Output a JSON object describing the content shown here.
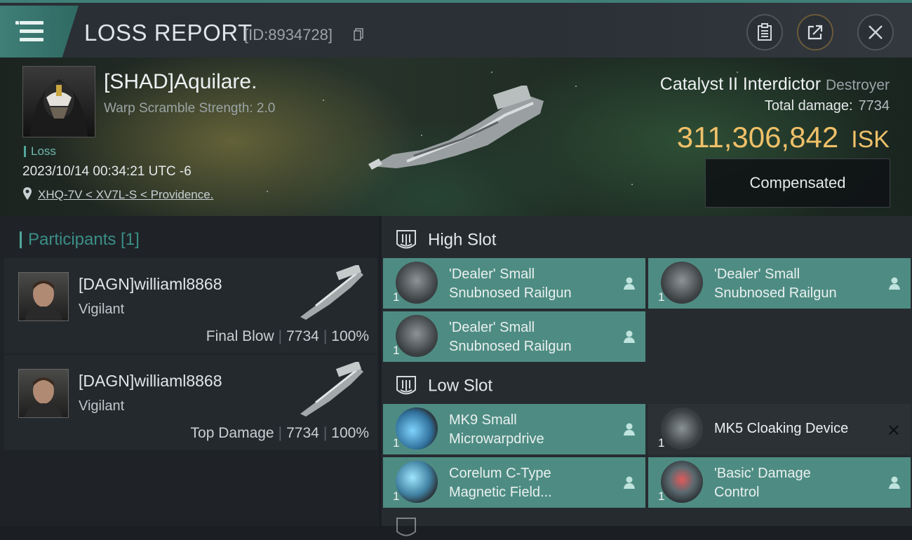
{
  "header": {
    "title": "LOSS REPORT",
    "report_id": "[ID:8934728]"
  },
  "victim": {
    "pilot": "[SHAD]Aquilare.",
    "warp_scramble": "Warp Scramble Strength: 2.0",
    "tag": "Loss",
    "timestamp": "2023/10/14 00:34:21 UTC -6",
    "location": "XHQ-7V < XV7L-S < Providence."
  },
  "ship": {
    "name": "Catalyst II Interdictor",
    "class": "Destroyer",
    "total_damage_label": "Total damage:",
    "total_damage": "7734",
    "isk_value": "311,306,842",
    "isk_unit": "ISK",
    "compensated_label": "Compensated"
  },
  "participants": {
    "header": "Participants [1]",
    "items": [
      {
        "name": "[DAGN]williaml8868",
        "ship": "Vigilant",
        "role": "Final Blow",
        "damage": "7734",
        "percent": "100%"
      },
      {
        "name": "[DAGN]williaml8868",
        "ship": "Vigilant",
        "role": "Top Damage",
        "damage": "7734",
        "percent": "100%"
      }
    ]
  },
  "fittings": {
    "high_slot": {
      "label": "High Slot",
      "modules": [
        {
          "line1": "'Dealer' Small",
          "line2": "Snubnosed Railgun",
          "qty": "1",
          "state": "dropped"
        },
        {
          "line1": "'Dealer' Small",
          "line2": "Snubnosed Railgun",
          "qty": "1",
          "state": "dropped"
        },
        {
          "line1": "'Dealer' Small",
          "line2": "Snubnosed Railgun",
          "qty": "1",
          "state": "dropped"
        }
      ]
    },
    "low_slot": {
      "label": "Low Slot",
      "modules": [
        {
          "line1": "MK9 Small",
          "line2": "Microwarpdrive",
          "qty": "1",
          "state": "dropped"
        },
        {
          "line1": "MK5 Cloaking Device",
          "line2": "",
          "qty": "1",
          "state": "destroyed"
        },
        {
          "line1": "Corelum C-Type",
          "line2": "Magnetic Field...",
          "qty": "1",
          "state": "dropped"
        },
        {
          "line1": "'Basic' Damage",
          "line2": "Control",
          "qty": "1",
          "state": "dropped"
        }
      ]
    }
  },
  "colors": {
    "accent": "#3f7f78",
    "isk": "#f0c069",
    "module_dropped": "#4e8c83",
    "module_destroyed": "#2c3136"
  }
}
